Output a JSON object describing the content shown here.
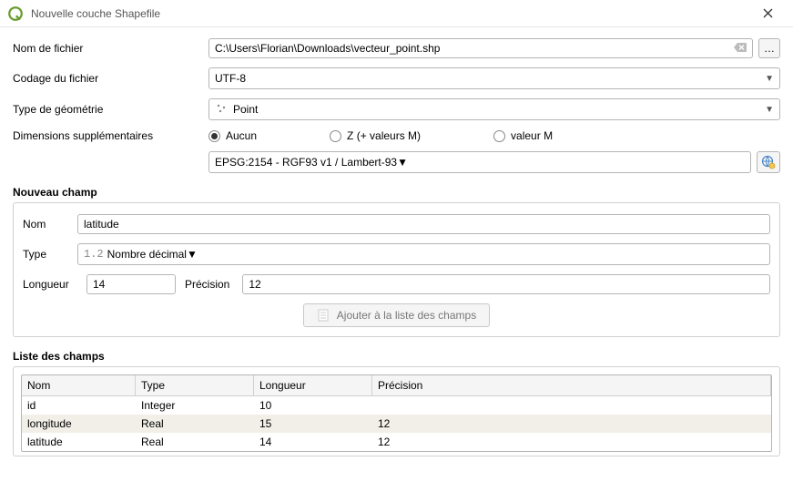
{
  "window": {
    "title": "Nouvelle couche Shapefile"
  },
  "filename": {
    "label": "Nom de fichier",
    "value": "C:\\Users\\Florian\\Downloads\\vecteur_point.shp"
  },
  "encoding": {
    "label": "Codage du fichier",
    "value": "UTF-8"
  },
  "geometry": {
    "label": "Type de géométrie",
    "value": "Point"
  },
  "dimensions": {
    "label": "Dimensions supplémentaires",
    "options": {
      "none": "Aucun",
      "zm": "Z (+ valeurs M)",
      "m": "valeur M"
    },
    "selected": "none"
  },
  "crs": {
    "value": "EPSG:2154 - RGF93 v1 / Lambert-93"
  },
  "new_field": {
    "header": "Nouveau champ",
    "name_label": "Nom",
    "name_value": "latitude",
    "type_label": "Type",
    "type_prefix": "1.2",
    "type_value": "Nombre décimal",
    "length_label": "Longueur",
    "length_value": "14",
    "precision_label": "Précision",
    "precision_value": "12",
    "add_button": "Ajouter à la liste des champs"
  },
  "fields_list": {
    "header": "Liste des champs",
    "columns": {
      "name": "Nom",
      "type": "Type",
      "length": "Longueur",
      "precision": "Précision"
    },
    "rows": [
      {
        "name": "id",
        "type": "Integer",
        "length": "10",
        "precision": ""
      },
      {
        "name": "longitude",
        "type": "Real",
        "length": "15",
        "precision": "12"
      },
      {
        "name": "latitude",
        "type": "Real",
        "length": "14",
        "precision": "12"
      }
    ]
  }
}
